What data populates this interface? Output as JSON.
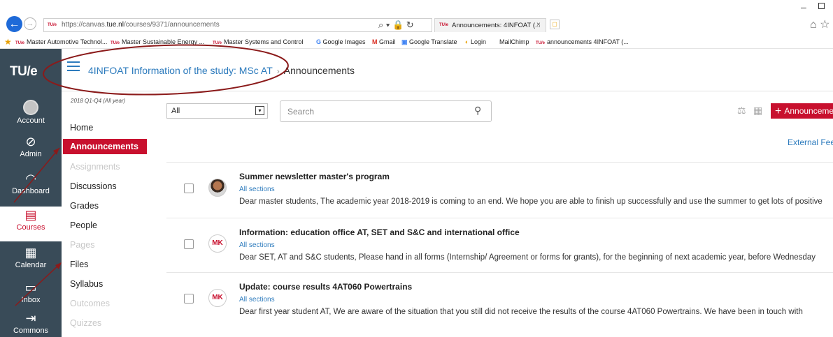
{
  "browser": {
    "url_prefix": "https://canvas.",
    "url_domain": "tue.nl",
    "url_path": "/courses/9371/announcements",
    "address_icons": "⌕ ▾ 🔒 ↻",
    "tab_favicon": "TU/e",
    "tab_title": "Announcements: 4INFOAT (...",
    "tab_close": "×",
    "new_tab": "▢",
    "window_min": "–",
    "window_icons": "⌂ ☆",
    "back_arrow": "←",
    "forward_arrow": "→",
    "favorites": [
      {
        "icon": "tue",
        "label": "Master Automotive Technol..."
      },
      {
        "icon": "tue",
        "label": "Master Sustainable Energy ..."
      },
      {
        "icon": "tue",
        "label": "Master Systems and Control"
      },
      {
        "icon": "google",
        "label": "Google Images"
      },
      {
        "icon": "gmail",
        "label": "Gmail"
      },
      {
        "icon": "translate",
        "label": "Google Translate"
      },
      {
        "icon": "login",
        "label": "Login"
      },
      {
        "icon": "none",
        "label": "MailChimp"
      },
      {
        "icon": "tue",
        "label": "announcements 4INFOAT (..."
      }
    ]
  },
  "global_nav": {
    "logo": "TU/e",
    "items": [
      {
        "label": "Account",
        "icon": "account-icon"
      },
      {
        "label": "Admin",
        "icon": "admin-icon"
      },
      {
        "label": "Dashboard",
        "icon": "dashboard-icon"
      },
      {
        "label": "Courses",
        "icon": "courses-icon",
        "active": true
      },
      {
        "label": "Calendar",
        "icon": "calendar-icon"
      },
      {
        "label": "Inbox",
        "icon": "inbox-icon"
      },
      {
        "label": "Commons",
        "icon": "commons-icon"
      }
    ]
  },
  "header": {
    "course_name": "4INFOAT Information of the study: MSc AT",
    "separator": "›",
    "current": "Announcements"
  },
  "course_nav": {
    "term": "2018 Q1-Q4 (All year)",
    "items": [
      {
        "label": "Home",
        "state": "normal"
      },
      {
        "label": "Announcements",
        "state": "active"
      },
      {
        "label": "Assignments",
        "state": "disabled"
      },
      {
        "label": "Discussions",
        "state": "normal"
      },
      {
        "label": "Grades",
        "state": "normal"
      },
      {
        "label": "People",
        "state": "normal"
      },
      {
        "label": "Pages",
        "state": "disabled"
      },
      {
        "label": "Files",
        "state": "normal"
      },
      {
        "label": "Syllabus",
        "state": "normal"
      },
      {
        "label": "Outcomes",
        "state": "disabled"
      },
      {
        "label": "Quizzes",
        "state": "disabled"
      }
    ]
  },
  "toolbar": {
    "filter_value": "All",
    "filter_arrow": "▾",
    "search_placeholder": "Search",
    "add_label": "Announcement",
    "add_plus": "+",
    "external_feeds": "External Feeds"
  },
  "announcements": [
    {
      "title": "Summer newsletter master's program",
      "sections": "All sections",
      "body": "Dear master students, The academic year 2018-2019 is coming to an end. We hope you are able to finish up successfully and use the summer to get lots of positive",
      "avatar": "photo",
      "initials": ""
    },
    {
      "title": "Information: education office AT, SET and S&C and international office",
      "sections": "All sections",
      "body": "Dear SET, AT and S&C students, Please hand in all forms (Internship/ Agreement or forms for grants), for the beginning of next academic year, before Wednesday",
      "avatar": "initials",
      "initials": "MK"
    },
    {
      "title": "Update: course results 4AT060 Powertrains",
      "sections": "All sections",
      "body": "Dear first year student AT,  We are aware of the situation that you still did not receive the results of the course 4AT060 Powertrains. We have been in touch with",
      "avatar": "initials",
      "initials": "MK"
    }
  ],
  "colors": {
    "brand_red": "#c8102e",
    "link_blue": "#2d7bbd",
    "nav_bg": "#394b58",
    "annotation": "#8b1a1a"
  }
}
